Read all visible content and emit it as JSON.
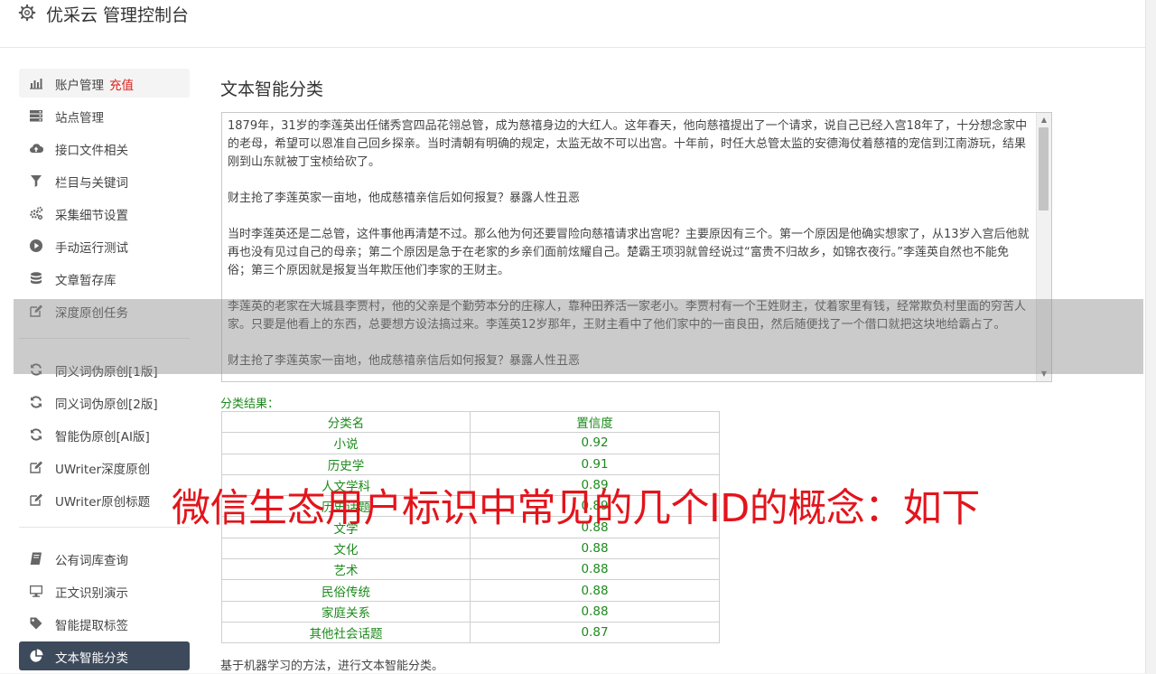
{
  "app": {
    "title": "优采云 管理控制台"
  },
  "sidebar": {
    "items": [
      {
        "label": "账户管理",
        "extra": "充值",
        "icon": "bar-chart-icon"
      },
      {
        "label": "站点管理",
        "icon": "server-icon"
      },
      {
        "label": "接口文件相关",
        "icon": "cloud-upload-icon"
      },
      {
        "label": "栏目与关键词",
        "icon": "filter-icon"
      },
      {
        "label": "采集细节设置",
        "icon": "cogs-icon"
      },
      {
        "label": "手动运行测试",
        "icon": "play-circle-icon"
      },
      {
        "label": "文章暂存库",
        "icon": "database-icon"
      },
      {
        "label": "深度原创任务",
        "icon": "edit-icon"
      },
      {
        "label": "同义词伪原创[1版]",
        "icon": "refresh-icon"
      },
      {
        "label": "同义词伪原创[2版]",
        "icon": "refresh-icon"
      },
      {
        "label": "智能伪原创[AI版]",
        "icon": "refresh-icon"
      },
      {
        "label": "UWriter深度原创",
        "icon": "edit-icon"
      },
      {
        "label": "UWriter原创标题",
        "icon": "edit-icon"
      },
      {
        "label": "公有词库查询",
        "icon": "book-icon"
      },
      {
        "label": "正文识别演示",
        "icon": "monitor-icon"
      },
      {
        "label": "智能提取标签",
        "icon": "tag-icon"
      },
      {
        "label": "文本智能分类",
        "icon": "pie-chart-icon"
      }
    ]
  },
  "main": {
    "title": "文本智能分类",
    "text_paragraphs": [
      "1879年，31岁的李莲英出任储秀宫四品花翎总管，成为慈禧身边的大红人。这年春天，他向慈禧提出了一个请求，说自己已经入宫18年了，十分想念家中的老母，希望可以恩准自己回乡探亲。当时清朝有明确的规定，太监无故不可以出宫。十年前，时任大总管太监的安德海仗着慈禧的宠信到江南游玩，结果刚到山东就被丁宝桢给砍了。",
      "财主抢了李莲英家一亩地，他成慈禧亲信后如何报复？暴露人性丑恶",
      "当时李莲英还是二总管，这件事他再清楚不过。那么他为何还要冒险向慈禧请求出宫呢？主要原因有三个。第一个原因是他确实想家了，从13岁入宫后他就再也没有见过自己的母亲；第二个原因是急于在老家的乡亲们面前炫耀自己。楚霸王项羽就曾经说过“富贵不归故乡，如锦衣夜行。”李莲英自然也不能免俗；第三个原因就是报复当年欺压他们李家的王财主。",
      "李莲英的老家在大城县李贾村，他的父亲是个勤劳本分的庄稼人，靠种田养活一家老小。李贾村有一个王姓财主，仗着家里有钱，经常欺负村里面的穷苦人家。只要是他看上的东西，总要想方设法搞过来。李莲英12岁那年，王财主看中了他们家中的一亩良田，然后随便找了一个借口就把这块地给霸占了。",
      "财主抢了李莲英家一亩地，他成慈禧亲信后如何报复？暴露人性丑恶"
    ],
    "result_label": "分类结果：",
    "table": {
      "headers": [
        "分类名",
        "置信度"
      ],
      "rows": [
        [
          "小说",
          "0.92"
        ],
        [
          "历史学",
          "0.91"
        ],
        [
          "人文学科",
          "0.89"
        ],
        [
          "历史话题",
          "0.89"
        ],
        [
          "文学",
          "0.88"
        ],
        [
          "文化",
          "0.88"
        ],
        [
          "艺术",
          "0.88"
        ],
        [
          "民俗传统",
          "0.88"
        ],
        [
          "家庭关系",
          "0.88"
        ],
        [
          "其他社会话题",
          "0.87"
        ]
      ]
    },
    "description": "基于机器学习的方法，进行文本智能分类。"
  },
  "overlay": {
    "caption": "微信生态用户标识中常见的几个ID的概念：如下"
  },
  "colors": {
    "accent_green": "#1d8a1d",
    "active_nav": "#3d4a5c",
    "highlight_red": "#e0201c",
    "caption_red": "#e3141b"
  }
}
